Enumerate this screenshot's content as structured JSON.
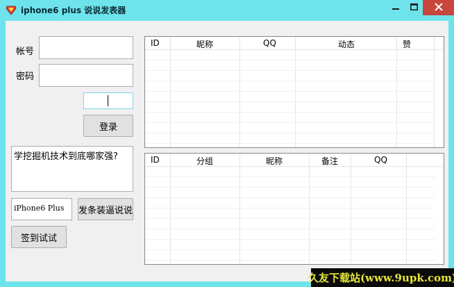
{
  "window": {
    "title": "iphone6 plus 说说发表器",
    "controls": {
      "minimize": "minimize",
      "maximize": "maximize",
      "close": "close"
    }
  },
  "login": {
    "account_label": "帐号",
    "account_value": "",
    "password_label": "密码",
    "password_value": "",
    "captcha_value": "",
    "login_button": "登录"
  },
  "post": {
    "content": "学挖掘机技术到底哪家强?",
    "device_value": "iPhone6 Plus",
    "send_button": "发条装逼说说",
    "checkin_button": "签到试试"
  },
  "feed_table": {
    "columns": [
      "ID",
      "昵称",
      "QQ",
      "动态",
      "赞"
    ],
    "rows": []
  },
  "friends_table": {
    "columns": [
      "ID",
      "分组",
      "昵称",
      "备注",
      "QQ"
    ],
    "rows": []
  },
  "watermark": "久友下载站(www.9upk.com)",
  "colors": {
    "titlebar": "#6ee3ec",
    "close_button": "#c9463d",
    "client_bg": "#f0f0f0",
    "watermark_bg": "#0a0a0a",
    "watermark_text": "#e6e63a"
  }
}
